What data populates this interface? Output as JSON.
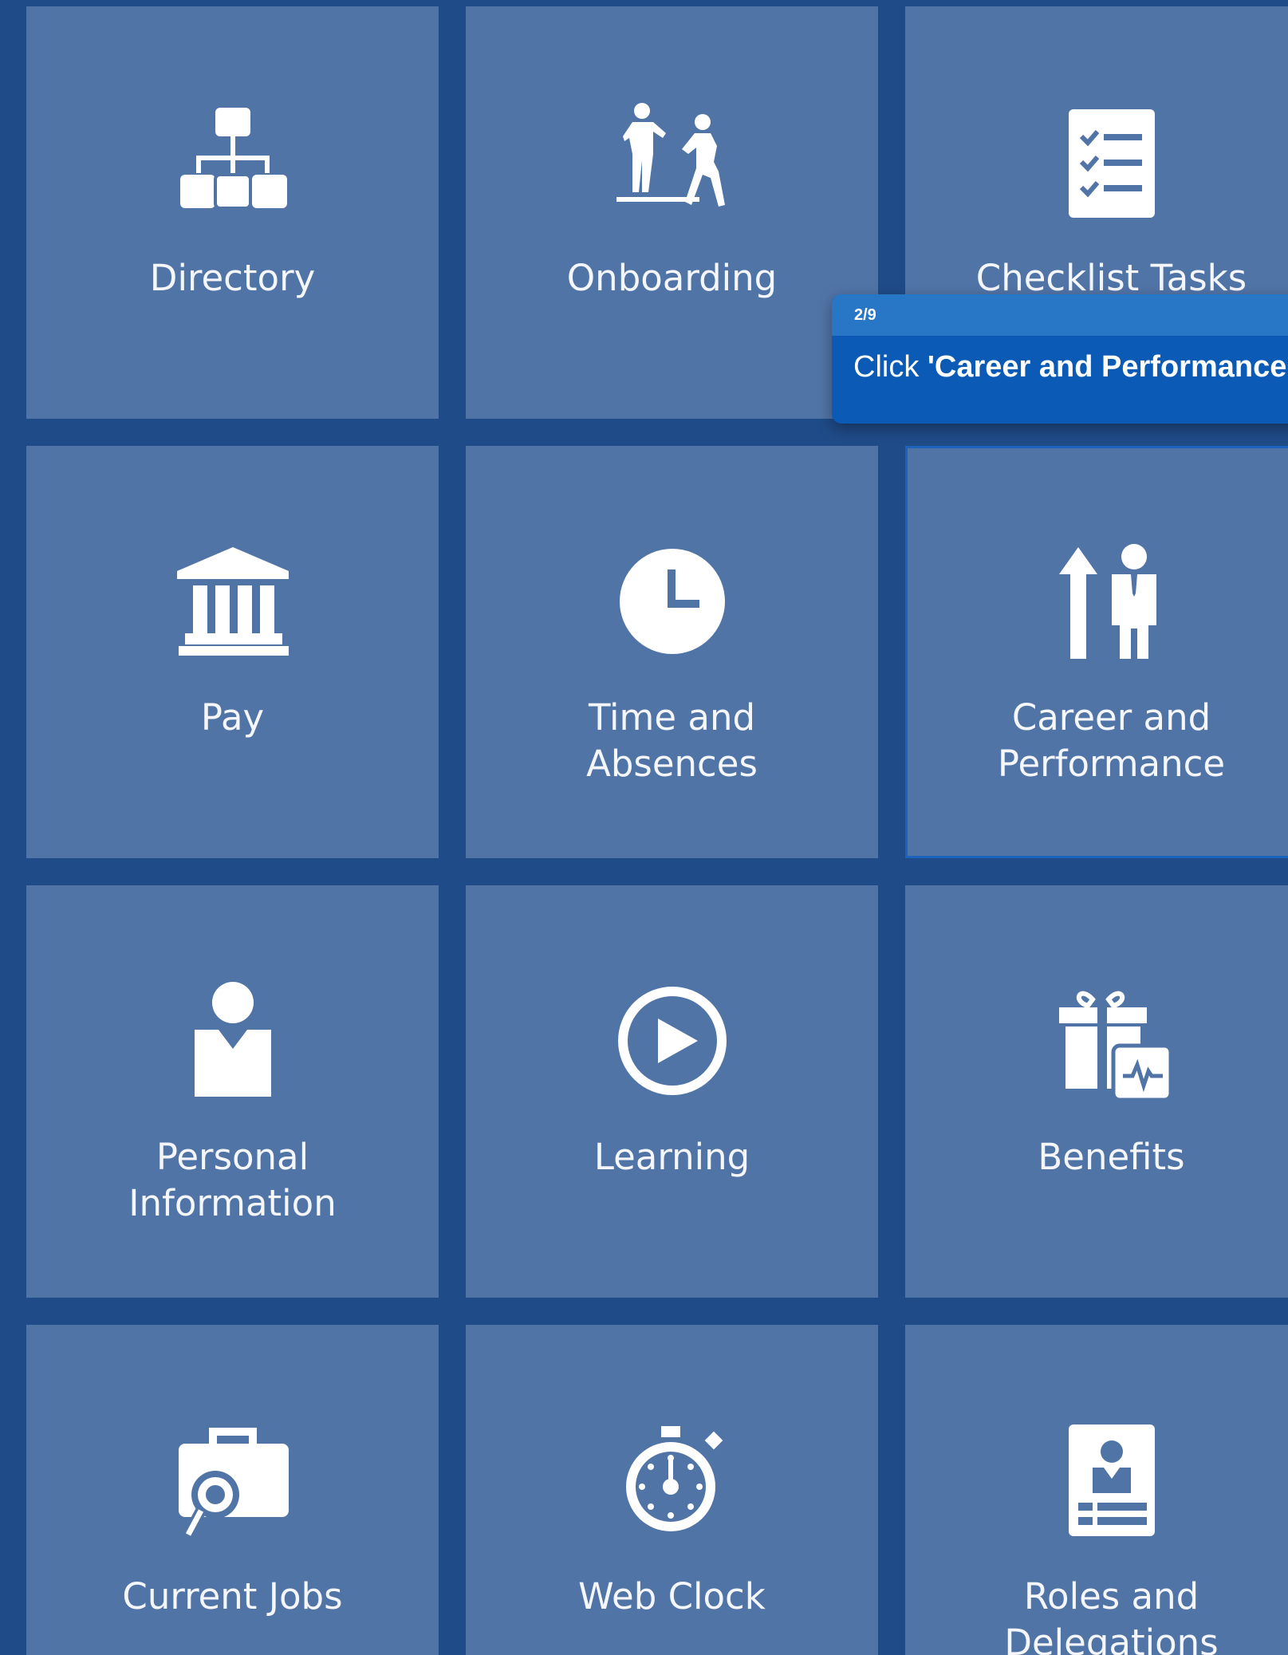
{
  "tiles": [
    {
      "label": "Directory",
      "icon": "org-chart-icon"
    },
    {
      "label": "Onboarding",
      "icon": "onboarding-people-icon"
    },
    {
      "label": "Checklist Tasks",
      "icon": "checklist-icon"
    },
    {
      "label": "Pay",
      "icon": "bank-icon"
    },
    {
      "label": "Time and Absences",
      "icon": "clock-icon"
    },
    {
      "label": "Career and Performance",
      "icon": "career-growth-icon"
    },
    {
      "label": "Personal Information",
      "icon": "person-icon"
    },
    {
      "label": "Learning",
      "icon": "play-circle-icon"
    },
    {
      "label": "Benefits",
      "icon": "gift-health-icon"
    },
    {
      "label": "Current Jobs",
      "icon": "job-search-icon"
    },
    {
      "label": "Web Clock",
      "icon": "stopwatch-icon"
    },
    {
      "label": "Roles and Delegations",
      "icon": "id-badge-icon"
    }
  ],
  "tooltip": {
    "step": "2/9",
    "prefix": "Click ",
    "target": "'Career and Performance'"
  },
  "colors": {
    "background": "#1f4b88",
    "tile": "#5174a7",
    "tooltip_body": "#0b5ab5",
    "tooltip_header": "#2877c7"
  }
}
